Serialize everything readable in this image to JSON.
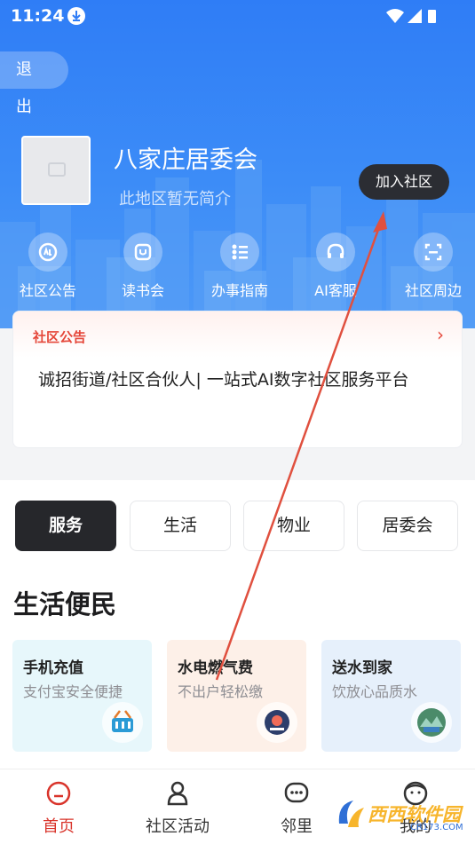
{
  "status_bar": {
    "time": "11:24"
  },
  "header": {
    "logout_label": "退 出",
    "community_name": "八家庄居委会",
    "community_desc": "此地区暂无简介",
    "join_label": "加入社区"
  },
  "quick_links": [
    {
      "label": "社区公告",
      "icon": "announcement-icon"
    },
    {
      "label": "读书会",
      "icon": "book-icon"
    },
    {
      "label": "办事指南",
      "icon": "guide-icon"
    },
    {
      "label": "AI客服",
      "icon": "headset-icon"
    },
    {
      "label": "社区周边",
      "icon": "scan-icon"
    }
  ],
  "notice": {
    "title": "社区公告",
    "text": "诚招街道/社区合伙人| 一站式AI数字社区服务平台"
  },
  "tabs": [
    {
      "label": "服务",
      "active": true
    },
    {
      "label": "生活",
      "active": false
    },
    {
      "label": "物业",
      "active": false
    },
    {
      "label": "居委会",
      "active": false
    }
  ],
  "section": {
    "title": "生活便民"
  },
  "services": [
    {
      "title": "手机充值",
      "subtitle": "支付宝安全便捷",
      "icon": "basket-icon",
      "bg": "#e7f7fb"
    },
    {
      "title": "水电燃气费",
      "subtitle": "不出户轻松缴",
      "icon": "meter-icon",
      "bg": "#fdf0e8"
    },
    {
      "title": "送水到家",
      "subtitle": "饮放心品质水",
      "icon": "water-icon",
      "bg": "#e6f0fb"
    }
  ],
  "bottom_nav": [
    {
      "label": "首页",
      "icon": "home-icon",
      "active": true
    },
    {
      "label": "社区活动",
      "icon": "activity-icon",
      "active": false
    },
    {
      "label": "邻里",
      "icon": "chat-icon",
      "active": false
    },
    {
      "label": "我的",
      "icon": "profile-icon",
      "active": false
    }
  ],
  "watermark": {
    "text": "西西软件园",
    "sub": "CR173.COM"
  },
  "colors": {
    "primary": "#2f7df6",
    "accent_red": "#e5473a",
    "dark": "#26272b"
  }
}
